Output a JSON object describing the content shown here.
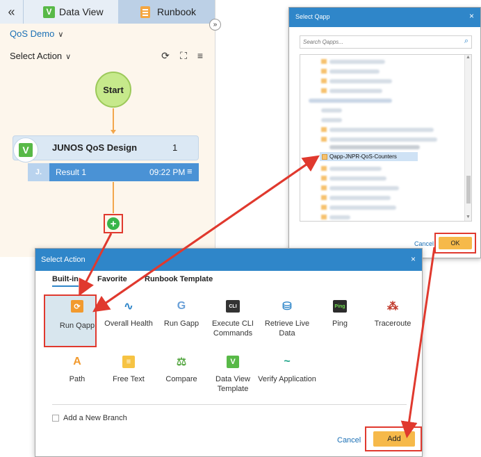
{
  "runbook_panel": {
    "collapse_glyph": "«",
    "tabs": [
      {
        "label": "Data View",
        "icon": "v-badge-icon"
      },
      {
        "label": "Runbook",
        "icon": "notebook-icon"
      }
    ],
    "expand_glyph": "»",
    "runbook_name": "QoS Demo",
    "select_action": "Select Action",
    "toolbar_icons": [
      "refresh-icon",
      "fit-to-screen-icon",
      "hamburger-menu-icon"
    ],
    "start_node": "Start",
    "node": {
      "badge": "V",
      "title": "JUNOS QoS Design",
      "count": "1",
      "result": {
        "badge": "J.",
        "label": "Result 1",
        "time": "09:22 PM"
      }
    },
    "add_button": "+"
  },
  "qapp_dialog": {
    "title": "Select Qapp",
    "close": "×",
    "search_placeholder": "Search Qapps...",
    "selected_item": "Qapp-JNPR-QoS-Counters",
    "cancel": "Cancel",
    "ok": "OK"
  },
  "action_dialog": {
    "title": "Select Action",
    "close": "×",
    "tabs": [
      "Built-in",
      "Favorite",
      "Runbook Template"
    ],
    "actions": [
      {
        "label": "Run Qapp",
        "icon": "run-qapp-icon",
        "glyph": "⟳",
        "color": "#f29a2e"
      },
      {
        "label": "Overall Health",
        "icon": "health-pulse-icon",
        "glyph": "∿",
        "color": "#2f86c9"
      },
      {
        "label": "Run Gapp",
        "icon": "gapp-icon",
        "glyph": "G",
        "color": "#6aa0d8"
      },
      {
        "label": "Execute CLI Commands",
        "icon": "cli-icon",
        "glyph": "CLI",
        "color": "#333333"
      },
      {
        "label": "Retrieve Live Data",
        "icon": "live-data-icon",
        "glyph": "⛁",
        "color": "#2f86c9"
      },
      {
        "label": "Ping",
        "icon": "ping-icon",
        "glyph": "Ping",
        "color": "#2b2b2b"
      },
      {
        "label": "Traceroute",
        "icon": "traceroute-icon",
        "glyph": "⁂",
        "color": "#c0392b"
      },
      {
        "label": "Path",
        "icon": "path-icon",
        "glyph": "A",
        "color": "#f29a2e"
      },
      {
        "label": "Free Text",
        "icon": "free-text-icon",
        "glyph": "≡",
        "color": "#f6c343"
      },
      {
        "label": "Compare",
        "icon": "compare-scale-icon",
        "glyph": "⚖",
        "color": "#58a845"
      },
      {
        "label": "Data View Template",
        "icon": "data-view-template-icon",
        "glyph": "V",
        "color": "#58b947"
      },
      {
        "label": "Verify Application",
        "icon": "verify-application-icon",
        "glyph": "~",
        "color": "#1fa58a"
      }
    ],
    "add_branch": "Add a New Branch",
    "cancel": "Cancel",
    "add": "Add"
  },
  "colors": {
    "accent_blue": "#2f86c9",
    "highlight_red": "#e0392e",
    "primary_button": "#f6b94a"
  }
}
